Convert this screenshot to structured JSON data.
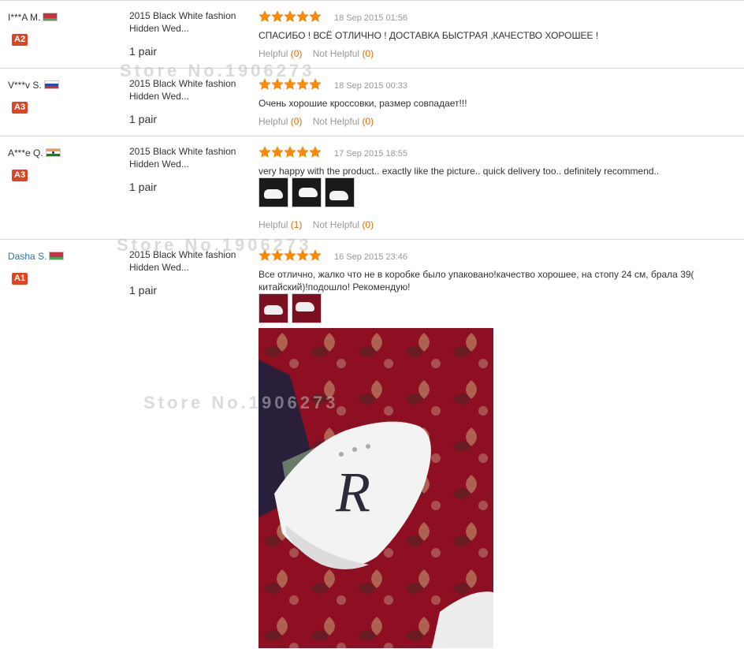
{
  "reviews": [
    {
      "buyer": "I***A M.",
      "buyer_flag": "flag-belarus-icon",
      "level": "A2",
      "product": "2015 Black White fashion Hidden Wed...",
      "quantity": "1 pair",
      "rating": 5,
      "date": "18 Sep 2015 01:56",
      "comment": "СПАСИБО ! ВСЁ ОТЛИЧНО ! ДОСТАВКА БЫСТРАЯ ,КАЧЕСТВО ХОРОШЕЕ !",
      "helpful_label": "Helpful",
      "helpful_count": "(0)",
      "not_helpful_label": "Not Helpful",
      "not_helpful_count": "(0)"
    },
    {
      "buyer": "V***v S.",
      "buyer_flag": "flag-russia-icon",
      "level": "A3",
      "product": "2015 Black White fashion Hidden Wed...",
      "quantity": "1 pair",
      "rating": 5,
      "date": "18 Sep 2015 00:33",
      "comment": "Очень хорошие кроссовки, размер совпадает!!!",
      "helpful_label": "Helpful",
      "helpful_count": "(0)",
      "not_helpful_label": "Not Helpful",
      "not_helpful_count": "(0)"
    },
    {
      "buyer": "A***e Q.",
      "buyer_flag": "flag-india-icon",
      "level": "A3",
      "product": "2015 Black White fashion Hidden Wed...",
      "quantity": "1 pair",
      "rating": 5,
      "date": "17 Sep 2015 18:55",
      "comment": "very happy with the product.. exactly like the picture.. quick delivery too.. definitely recommend..",
      "helpful_label": "Helpful",
      "helpful_count": "(1)",
      "not_helpful_label": "Not Helpful",
      "not_helpful_count": "(0)"
    },
    {
      "buyer": "Dasha S.",
      "buyer_flag": "flag-belarus-icon",
      "level": "A1",
      "product": "2015 Black White fashion Hidden Wed...",
      "quantity": "1 pair",
      "rating": 5,
      "date": "16 Sep 2015 23:46",
      "comment": "Все отлично, жалко что не в коробке было упаковано!качество хорошее, на стопу 24 см, брала 39( китайский)!подошло! Рекомендую!"
    }
  ],
  "watermark": "Store No.1906273",
  "colors": {
    "star": "#ff8a00",
    "level_badge": "#e0431f",
    "count": "#e36c0a",
    "link": "#2a72b8"
  }
}
